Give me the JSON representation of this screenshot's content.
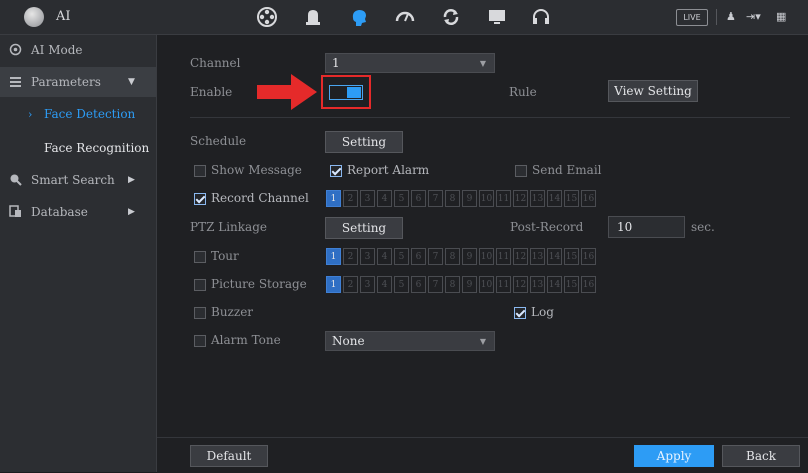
{
  "app": {
    "title": "AI"
  },
  "topbar": {
    "icons": [
      "reel-icon",
      "bell-icon",
      "ai-brain-icon",
      "gauge-icon",
      "refresh-icon",
      "monitor-icon",
      "headset-icon"
    ],
    "live_label": "LIVE",
    "right_icons": [
      "user-icon",
      "logout-icon",
      "grid-icon"
    ]
  },
  "sidebar": {
    "items": [
      {
        "label": "AI Mode",
        "icon": "ai-mode-icon"
      },
      {
        "label": "Parameters",
        "icon": "list-icon",
        "expanded": true
      },
      {
        "label": "Smart Search",
        "icon": "search-icon"
      },
      {
        "label": "Database",
        "icon": "database-icon"
      }
    ],
    "sub_items": [
      {
        "label": "Face Detection",
        "selected": true
      },
      {
        "label": "Face Recognition",
        "selected": false
      }
    ]
  },
  "form": {
    "channel_label": "Channel",
    "channel_value": "1",
    "enable_label": "Enable",
    "enable_on": true,
    "rule_label": "Rule",
    "view_setting_label": "View Setting",
    "schedule_label": "Schedule",
    "schedule_button": "Setting",
    "show_message_label": "Show Message",
    "show_message_checked": false,
    "report_alarm_label": "Report Alarm",
    "report_alarm_checked": true,
    "send_email_label": "Send Email",
    "send_email_checked": false,
    "record_channel_label": "Record Channel",
    "record_channel_checked": true,
    "ptz_linkage_label": "PTZ Linkage",
    "ptz_button": "Setting",
    "post_record_label": "Post-Record",
    "post_record_value": "10",
    "post_record_unit": "sec.",
    "tour_label": "Tour",
    "tour_checked": false,
    "picture_storage_label": "Picture Storage",
    "picture_storage_checked": false,
    "buzzer_label": "Buzzer",
    "buzzer_checked": false,
    "log_label": "Log",
    "log_checked": true,
    "alarm_tone_label": "Alarm Tone",
    "alarm_tone_checked": false,
    "alarm_tone_value": "None",
    "channels": [
      "1",
      "2",
      "3",
      "4",
      "5",
      "6",
      "7",
      "8",
      "9",
      "10",
      "11",
      "12",
      "13",
      "14",
      "15",
      "16"
    ]
  },
  "footer": {
    "default_label": "Default",
    "apply_label": "Apply",
    "back_label": "Back"
  },
  "colors": {
    "accent": "#2d9cf5",
    "highlight_box": "#e52a2a",
    "channel_selected": "#2f6fc4"
  }
}
